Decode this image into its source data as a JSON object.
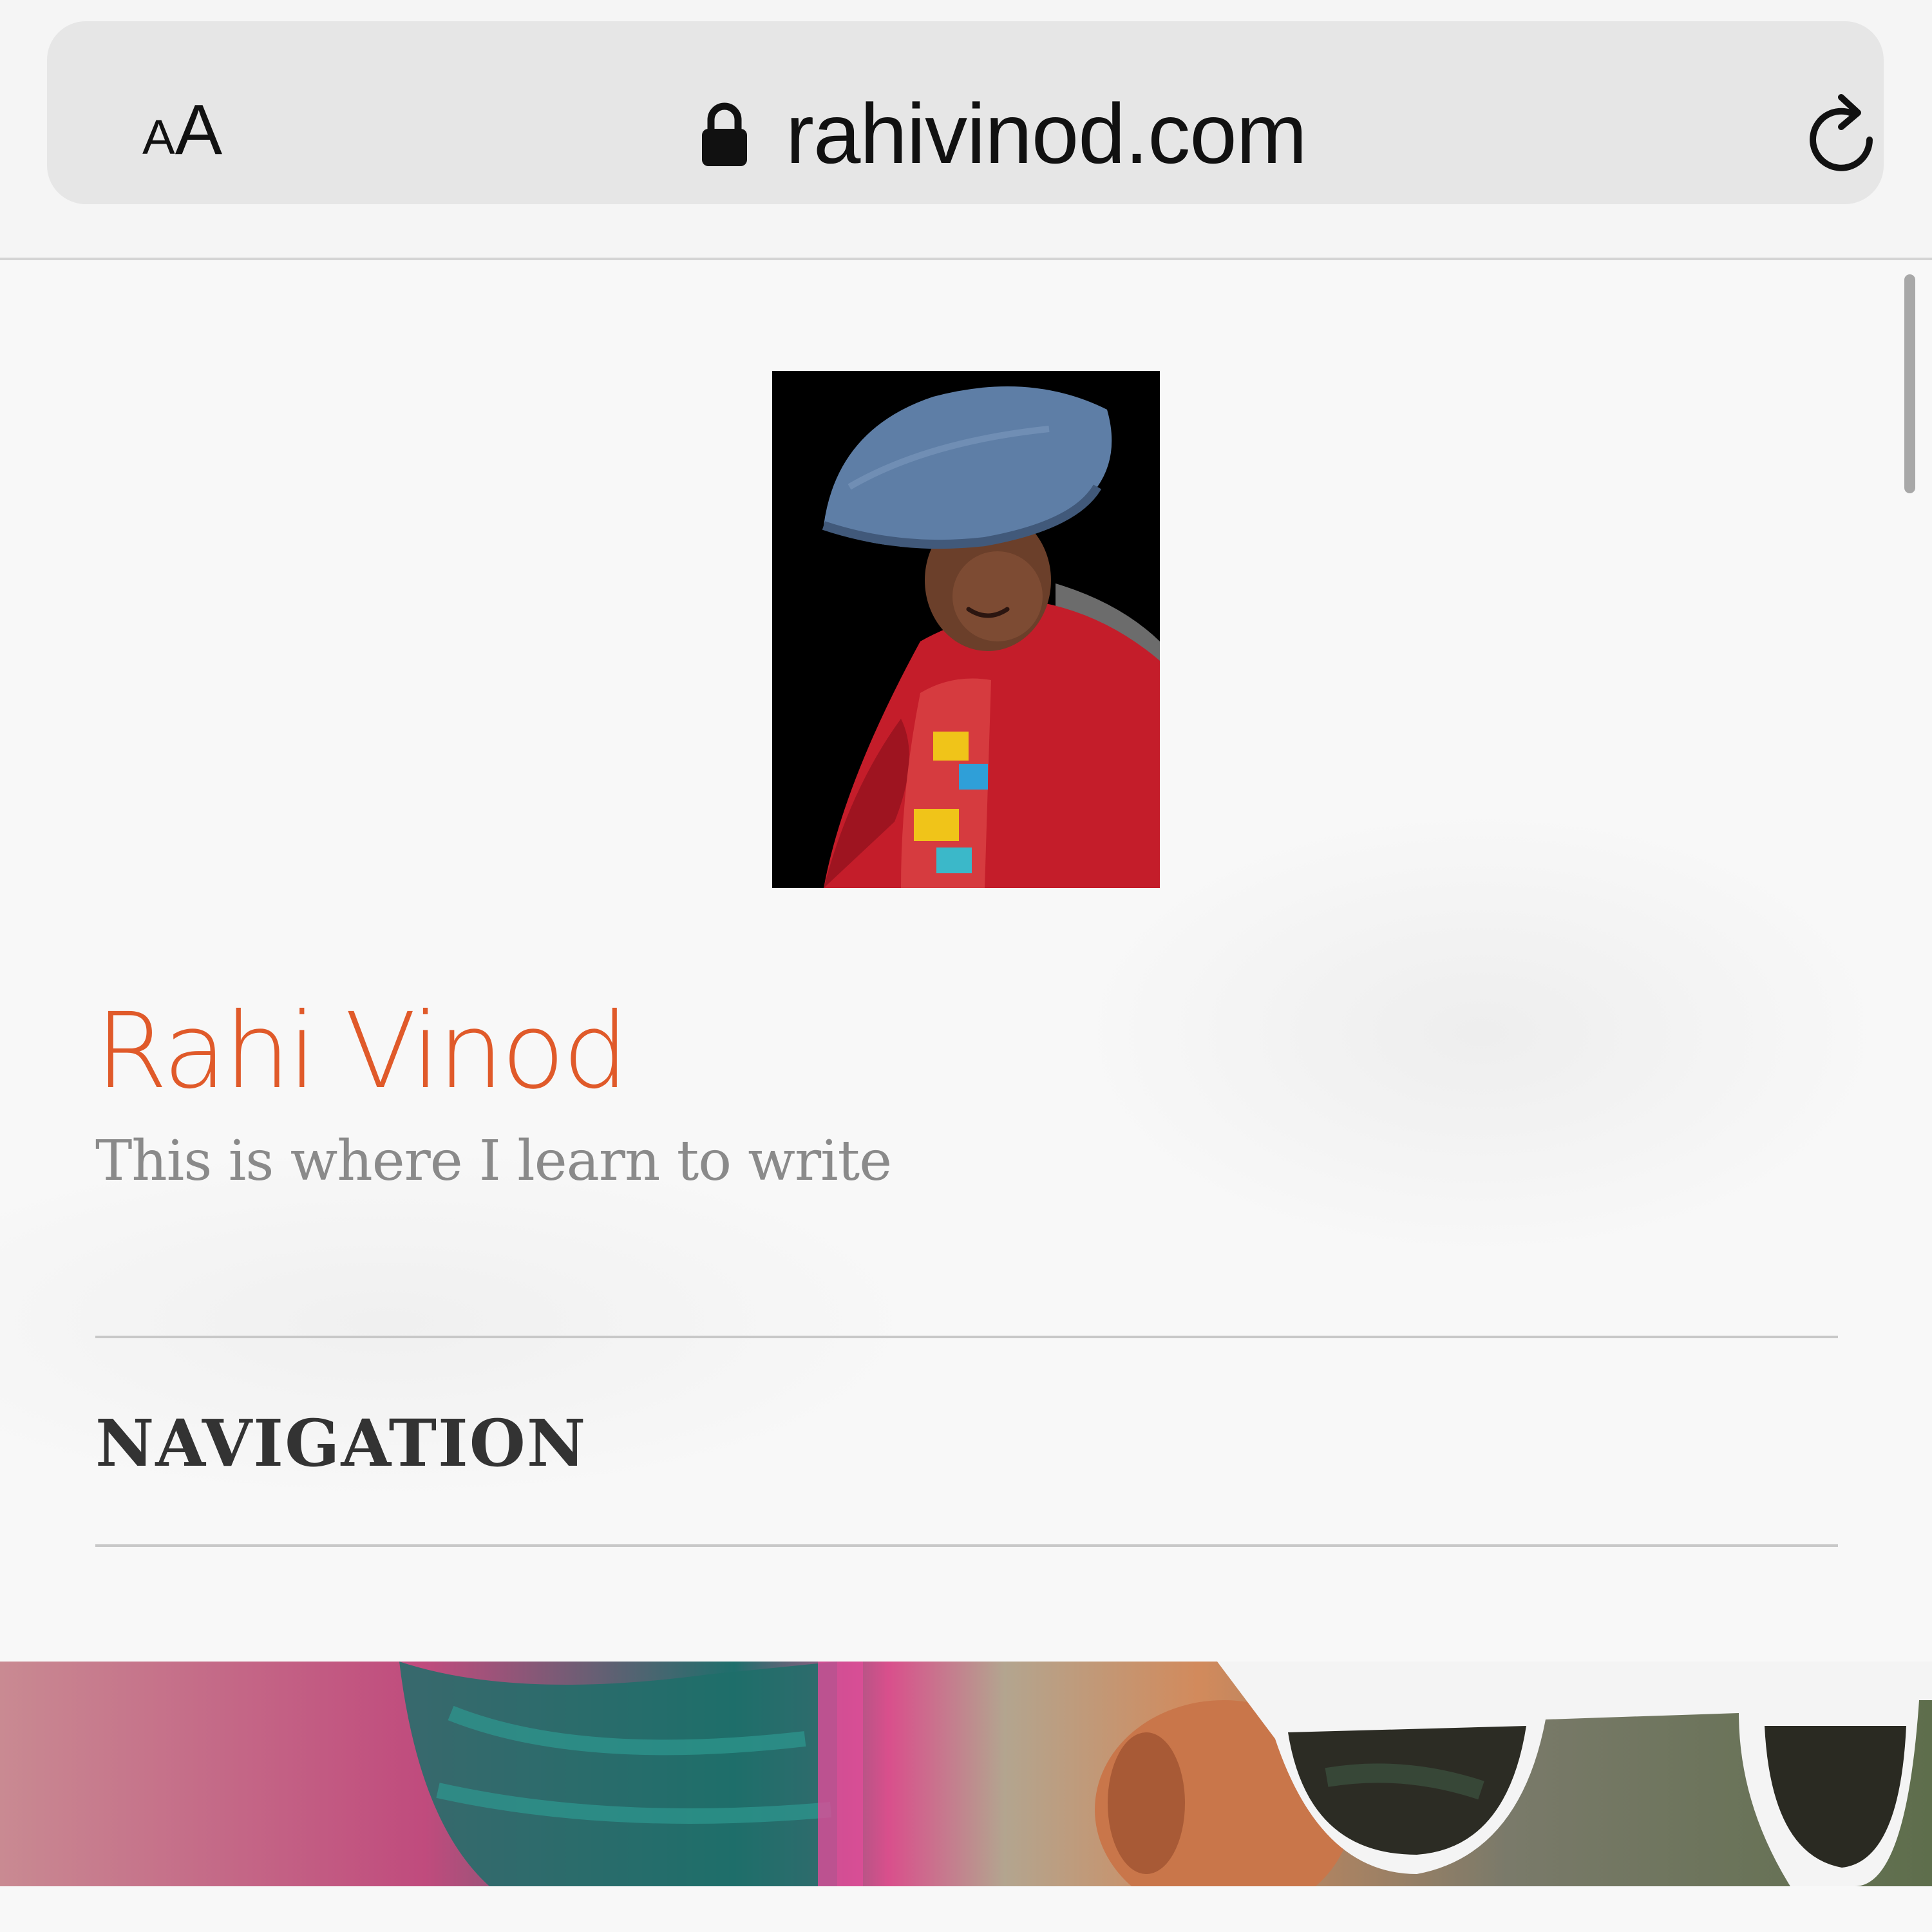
{
  "browser": {
    "text_size_button": {
      "small": "A",
      "large": "A"
    },
    "url": "rahivinod.com",
    "icons": {
      "lock": "lock-icon",
      "reload": "reload-icon"
    }
  },
  "site": {
    "title": "Rahi Vinod",
    "tagline": "This is where I learn to write",
    "navigation_label": "NAVIGATION"
  },
  "colors": {
    "title_accent": "#e05a2a",
    "tagline": "#8a8a8a",
    "nav_text": "#333333",
    "address_bar": "#e6e6e6"
  }
}
